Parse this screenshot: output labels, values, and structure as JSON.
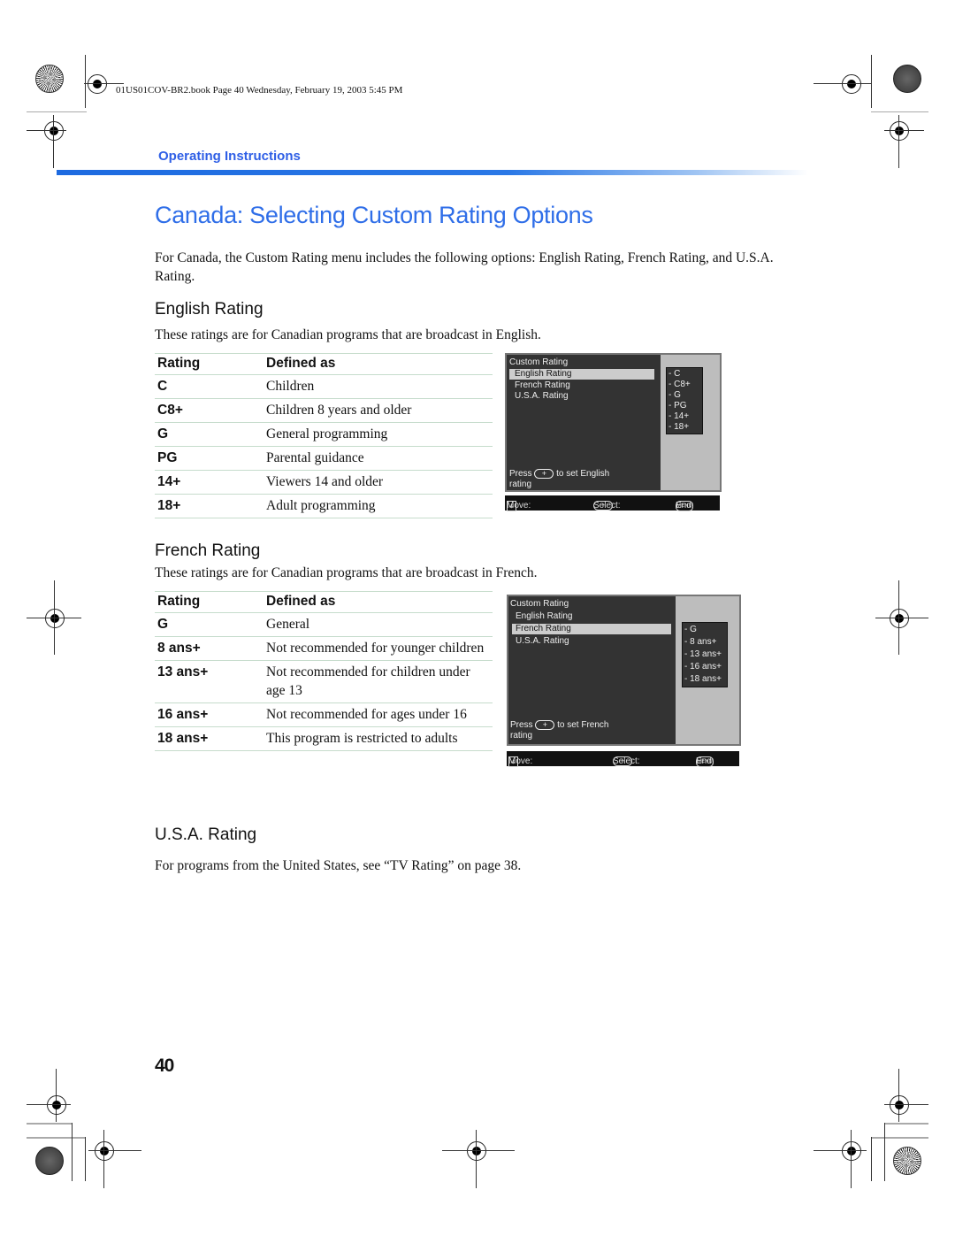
{
  "file_header": "01US01COV-BR2.book  Page 40  Wednesday, February 19, 2003  5:45 PM",
  "section_label": "Operating Instructions",
  "page_title": "Canada: Selecting Custom Rating Options",
  "intro": "For Canada, the Custom Rating menu includes the following options: English Rating, French Rating, and U.S.A. Rating.",
  "english": {
    "heading": "English Rating",
    "description": "These ratings are for Canadian programs that are broadcast in English.",
    "table": {
      "headers": [
        "Rating",
        "Defined as"
      ],
      "rows": [
        {
          "code": "C",
          "definition": "Children"
        },
        {
          "code": "C8+",
          "definition": "Children 8 years and older"
        },
        {
          "code": "G",
          "definition": "General programming"
        },
        {
          "code": "PG",
          "definition": "Parental guidance"
        },
        {
          "code": "14+",
          "definition": "Viewers 14 and older"
        },
        {
          "code": "18+",
          "definition": "Adult programming"
        }
      ]
    },
    "tv_menu": {
      "title": "Custom Rating",
      "items": [
        "English Rating",
        "French Rating",
        "U.S.A. Rating"
      ],
      "selected": "English Rating",
      "options": [
        "- C",
        "- C8+",
        "- G",
        "- PG",
        "- 14+",
        "- 18+"
      ],
      "press_prefix": "Press",
      "press_suffix": "to set English",
      "press_line2": "rating",
      "bar": {
        "move": "Move:",
        "select": "Select:",
        "end": "End:"
      }
    }
  },
  "french": {
    "heading": "French Rating",
    "description": "These ratings are for Canadian programs that are broadcast in French.",
    "table": {
      "headers": [
        "Rating",
        "Defined as"
      ],
      "rows": [
        {
          "code": "G",
          "definition": "General"
        },
        {
          "code": "8 ans+",
          "definition": "Not recommended for younger children"
        },
        {
          "code": "13 ans+",
          "definition": "Not recommended for children under age 13"
        },
        {
          "code": "16 ans+",
          "definition": "Not recommended for ages under 16"
        },
        {
          "code": "18 ans+",
          "definition": "This program is restricted to adults"
        }
      ]
    },
    "tv_menu": {
      "title": "Custom Rating",
      "items": [
        "English Rating",
        "French Rating",
        "U.S.A. Rating"
      ],
      "selected": "French Rating",
      "options": [
        "- G",
        "- 8 ans+",
        "- 13 ans+",
        "- 16 ans+",
        "- 18 ans+"
      ],
      "press_prefix": "Press",
      "press_suffix": "to set French",
      "press_line2": "rating",
      "bar": {
        "move": "Move:",
        "select": "Select:",
        "end": "End:"
      }
    }
  },
  "usa": {
    "heading": "U.S.A. Rating",
    "description": "For programs from the United States, see “TV Rating” on page 38."
  },
  "icons": {
    "arrow_keys": [
      "↑",
      "↓",
      "←",
      "→"
    ],
    "plus_button": "+",
    "menu_button": "MENU"
  },
  "page_number": "40",
  "colors": {
    "title_blue": "#2f6ee8",
    "section_blue": "#2f5fe6"
  }
}
